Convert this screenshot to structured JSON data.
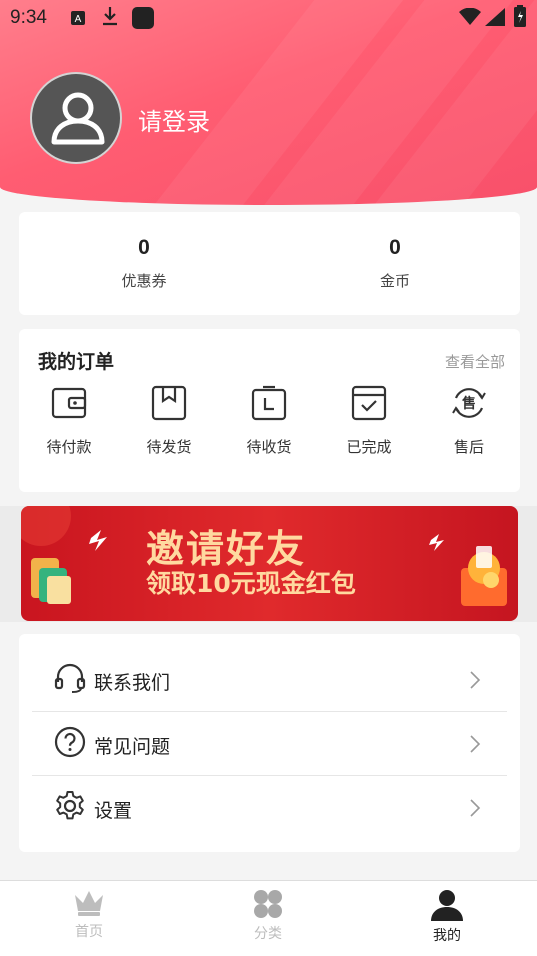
{
  "status_bar": {
    "time": "9:34"
  },
  "profile": {
    "login_prompt": "请登录"
  },
  "stats": [
    {
      "value": "0",
      "label": "优惠券"
    },
    {
      "value": "0",
      "label": "金币"
    }
  ],
  "orders": {
    "title": "我的订单",
    "view_all": "查看全部",
    "items": [
      {
        "label": "待付款",
        "icon": "wallet-icon"
      },
      {
        "label": "待发货",
        "icon": "package-icon"
      },
      {
        "label": "待收货",
        "icon": "receive-box-icon"
      },
      {
        "label": "已完成",
        "icon": "check-box-icon"
      },
      {
        "label": "售后",
        "icon": "after-sale-icon"
      }
    ]
  },
  "banner": {
    "headline": "邀请好友",
    "subline": "领取10元现金红包"
  },
  "menu": [
    {
      "label": "联系我们",
      "icon": "headset-icon"
    },
    {
      "label": "常见问题",
      "icon": "question-icon"
    },
    {
      "label": "设置",
      "icon": "gear-icon"
    }
  ],
  "tabbar": [
    {
      "label": "首页",
      "icon": "crown-icon",
      "active": false
    },
    {
      "label": "分类",
      "icon": "grid-icon",
      "active": false
    },
    {
      "label": "我的",
      "icon": "user-icon",
      "active": true
    }
  ],
  "colors": {
    "header_gradient_start": "#ff7e8c",
    "header_gradient_end": "#f8506a",
    "banner_red": "#d81e25",
    "banner_text": "#ffd9a0",
    "tab_inactive": "#bdbdbd",
    "tab_active": "#222222"
  }
}
